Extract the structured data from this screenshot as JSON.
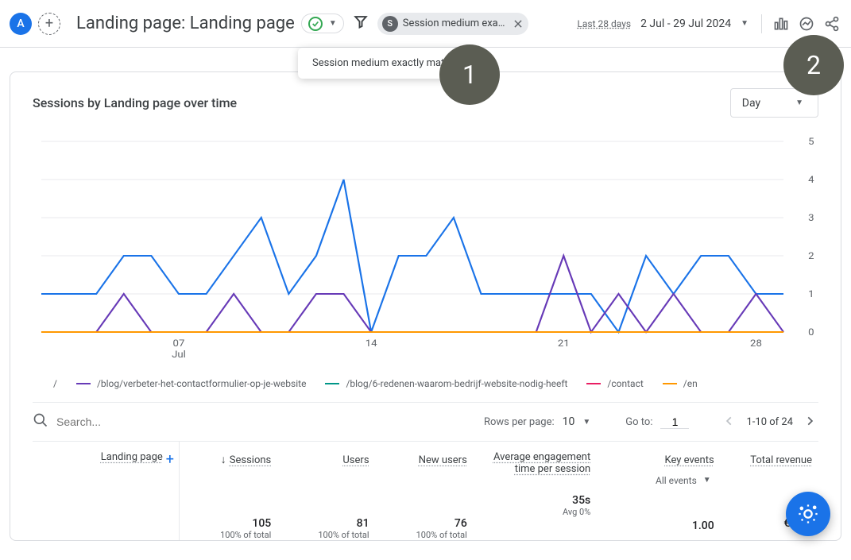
{
  "header": {
    "avatar_letter": "A",
    "add_icon": "+",
    "title": "Landing page: Landing page",
    "filter_chip_letter": "S",
    "filter_chip_label": "Session medium exact...",
    "date_label": "Last 28 days",
    "date_range": "2 Jul - 29 Jul 2024"
  },
  "tooltip": {
    "text": "Session medium exactly match..."
  },
  "annotations": {
    "one": "1",
    "two": "2"
  },
  "card": {
    "title": "Sessions by Landing page over time",
    "granularity": "Day"
  },
  "chart_data": {
    "type": "line",
    "xlabel": "",
    "ylabel": "",
    "ylim": [
      0,
      5
    ],
    "yticks": [
      0,
      1,
      2,
      3,
      4,
      5
    ],
    "x_dates": [
      "2",
      "3",
      "4",
      "5",
      "6",
      "7",
      "8",
      "9",
      "10",
      "11",
      "12",
      "13",
      "14",
      "15",
      "16",
      "17",
      "18",
      "19",
      "20",
      "21",
      "22",
      "23",
      "24",
      "25",
      "26",
      "27",
      "28",
      "29"
    ],
    "x_tick_labels": [
      "07",
      "14",
      "21",
      "28"
    ],
    "x_tick_sub": "Jul",
    "series": [
      {
        "name": "/",
        "color": "#1a73e8",
        "values": [
          1,
          1,
          1,
          2,
          2,
          1,
          1,
          2,
          3,
          1,
          2,
          4,
          0,
          2,
          2,
          3,
          1,
          1,
          1,
          1,
          1,
          0,
          2,
          1,
          2,
          2,
          1,
          1
        ]
      },
      {
        "name": "/blog/verbeter-het-contactformulier-op-je-website",
        "color": "#673ab7",
        "values": [
          0,
          0,
          0,
          1,
          0,
          0,
          0,
          1,
          0,
          0,
          1,
          1,
          0,
          0,
          0,
          0,
          0,
          0,
          0,
          2,
          0,
          1,
          0,
          1,
          0,
          0,
          1,
          0
        ]
      },
      {
        "name": "/blog/6-redenen-waarom-bedrijf-website-nodig-heeft",
        "color": "#009688",
        "values": [
          0,
          0,
          0,
          0,
          0,
          0,
          0,
          0,
          0,
          0,
          0,
          0,
          0,
          0,
          0,
          0,
          0,
          0,
          0,
          0,
          0,
          0,
          0,
          0,
          0,
          0,
          0,
          0
        ]
      },
      {
        "name": "/contact",
        "color": "#e91e63",
        "values": [
          0,
          0,
          0,
          0,
          0,
          0,
          0,
          0,
          0,
          0,
          0,
          0,
          0,
          0,
          0,
          0,
          0,
          0,
          0,
          0,
          0,
          0,
          0,
          0,
          0,
          0,
          0,
          0
        ]
      },
      {
        "name": "/en",
        "color": "#ff9800",
        "values": [
          0,
          0,
          0,
          0,
          0,
          0,
          0,
          0,
          0,
          0,
          0,
          0,
          0,
          0,
          0,
          0,
          0,
          0,
          0,
          0,
          0,
          0,
          0,
          0,
          0,
          0,
          0,
          0
        ]
      }
    ]
  },
  "legend": [
    {
      "label": "/",
      "color": "#1a73e8"
    },
    {
      "label": "/blog/verbeter-het-contactformulier-op-je-website",
      "color": "#673ab7"
    },
    {
      "label": "/blog/6-redenen-waarom-bedrijf-website-nodig-heeft",
      "color": "#009688"
    },
    {
      "label": "/contact",
      "color": "#e91e63"
    },
    {
      "label": "/en",
      "color": "#ff9800"
    }
  ],
  "table_controls": {
    "search_placeholder": "Search...",
    "rows_label": "Rows per page:",
    "rows_value": "10",
    "goto_label": "Go to:",
    "goto_value": "1",
    "page_info": "1-10 of 24"
  },
  "table": {
    "row_header": "Landing page",
    "columns": [
      {
        "label": "Sessions",
        "sorted": true
      },
      {
        "label": "Users"
      },
      {
        "label": "New users"
      },
      {
        "label": "Average engagement time per session"
      },
      {
        "label": "Key events",
        "sub": "All events"
      },
      {
        "label": "Total revenue"
      }
    ],
    "totals": [
      {
        "value": "105",
        "sub": "100% of total"
      },
      {
        "value": "81",
        "sub": "100% of total"
      },
      {
        "value": "76",
        "sub": "100% of total"
      },
      {
        "value": "35s",
        "sub": "Avg 0%"
      },
      {
        "value": "1.00",
        "sub": ""
      },
      {
        "value": "€0.00",
        "sub": ""
      }
    ]
  }
}
